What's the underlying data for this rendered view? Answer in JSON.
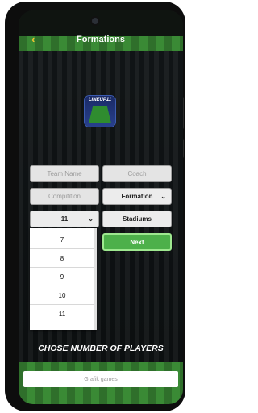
{
  "header": {
    "title": "Formations"
  },
  "logo": {
    "text": "LINEUP11"
  },
  "form": {
    "team_name_placeholder": "Team Name",
    "coach_placeholder": "Coach",
    "competition_placeholder": "Compitition",
    "formation_label": "Formation",
    "players_value": "11",
    "stadiums_label": "Stadiums",
    "next_label": "Next"
  },
  "dropdown": {
    "options": [
      "7",
      "8",
      "9",
      "10",
      "11"
    ]
  },
  "prompt": "CHOSE NUMBER OF PLAYERS",
  "ad": {
    "text": "Grafik games"
  },
  "colors": {
    "accent": "#f4c430",
    "next_green": "#4db04a",
    "pitch_green": "#3a8a35"
  },
  "icons": {
    "back": "back-chevron-icon",
    "dropdown": "chevron-down-icon"
  }
}
